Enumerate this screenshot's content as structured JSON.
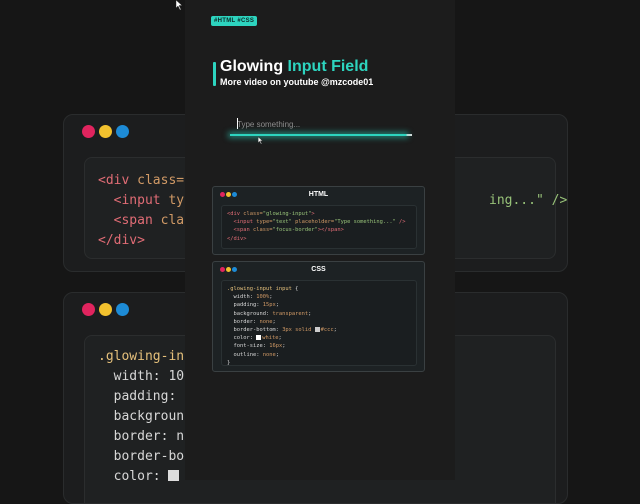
{
  "colors": {
    "accent": "#2dd4bf",
    "dot_red": "#e0245e",
    "dot_yellow": "#f2c12e",
    "dot_blue": "#1d8bd6"
  },
  "hashtags": "#HTML #CSS",
  "heading": {
    "title_part1": "Glowing ",
    "title_part2": "Input Field",
    "subtitle": "More video on youtube @mzcode01"
  },
  "demo": {
    "placeholder": "Type something..."
  },
  "html_card": {
    "title": "HTML",
    "lines": [
      [
        {
          "t": "<div ",
          "c": "tag"
        },
        {
          "t": "class=",
          "c": "attr"
        },
        {
          "t": "\"glowing-input\"",
          "c": "str"
        },
        {
          "t": ">",
          "c": "tag"
        }
      ],
      [
        {
          "t": "  <input ",
          "c": "tag"
        },
        {
          "t": "type=",
          "c": "attr"
        },
        {
          "t": "\"text\"",
          "c": "str"
        },
        {
          "t": " placeholder=",
          "c": "attr"
        },
        {
          "t": "\"Type something...\"",
          "c": "str"
        },
        {
          "t": " />",
          "c": "tag"
        }
      ],
      [
        {
          "t": "  <span ",
          "c": "tag"
        },
        {
          "t": "class=",
          "c": "attr"
        },
        {
          "t": "\"focus-border\"",
          "c": "str"
        },
        {
          "t": "></span>",
          "c": "tag"
        }
      ],
      [
        {
          "t": "</div>",
          "c": "tag"
        }
      ]
    ]
  },
  "css_card": {
    "title": "CSS",
    "lines": [
      [
        {
          "t": ".glowing-input input ",
          "c": "prop"
        },
        {
          "t": "{",
          "c": ""
        }
      ],
      [
        {
          "t": "  width: ",
          "c": ""
        },
        {
          "t": "100%",
          "c": "val"
        },
        {
          "t": ";",
          "c": ""
        }
      ],
      [
        {
          "t": "  padding: ",
          "c": ""
        },
        {
          "t": "15px",
          "c": "val"
        },
        {
          "t": ";",
          "c": ""
        }
      ],
      [
        {
          "t": "  background: ",
          "c": ""
        },
        {
          "t": "transparent",
          "c": "val"
        },
        {
          "t": ";",
          "c": ""
        }
      ],
      [
        {
          "t": "  border: ",
          "c": ""
        },
        {
          "t": "none",
          "c": "val"
        },
        {
          "t": ";",
          "c": ""
        }
      ],
      [
        {
          "t": "  border-bottom: ",
          "c": ""
        },
        {
          "t": "3px solid ",
          "c": "val"
        },
        {
          "s": "ccc"
        },
        {
          "t": "#ccc",
          "c": "val"
        },
        {
          "t": ";",
          "c": ""
        }
      ],
      [
        {
          "t": "  color: ",
          "c": ""
        },
        {
          "s": "white"
        },
        {
          "t": "white",
          "c": "val"
        },
        {
          "t": ";",
          "c": ""
        }
      ],
      [
        {
          "t": "  font-size: ",
          "c": ""
        },
        {
          "t": "16px",
          "c": "val"
        },
        {
          "t": ";",
          "c": ""
        }
      ],
      [
        {
          "t": "  outline: ",
          "c": ""
        },
        {
          "t": "none",
          "c": "val"
        },
        {
          "t": ";",
          "c": ""
        }
      ],
      [
        {
          "t": "}",
          "c": ""
        }
      ]
    ]
  },
  "bg_html_card": {
    "lines": [
      [
        {
          "t": "<div ",
          "c": "tag"
        },
        {
          "t": "class=",
          "c": "attr"
        }
      ],
      [
        {
          "t": "  <input ",
          "c": "tag"
        },
        {
          "t": "ty",
          "c": "attr"
        }
      ],
      [
        {
          "t": "  <span ",
          "c": "tag"
        },
        {
          "t": "cla",
          "c": "attr"
        }
      ],
      [
        {
          "t": "</div>",
          "c": "tag"
        }
      ]
    ],
    "right_fragment": "ing...\" />"
  },
  "bg_css_card": {
    "lines": [
      [
        {
          "t": ".glowing-in",
          "c": "prop"
        }
      ],
      [
        {
          "t": "  width: 10",
          "c": ""
        }
      ],
      [
        {
          "t": "  padding:",
          "c": ""
        }
      ],
      [
        {
          "t": "  backgroun",
          "c": ""
        }
      ],
      [
        {
          "t": "  border: n",
          "c": ""
        }
      ],
      [
        {
          "t": "  border-bo",
          "c": ""
        }
      ],
      [
        {
          "t": "  color: ",
          "c": ""
        },
        {
          "s": "bg"
        }
      ]
    ]
  }
}
